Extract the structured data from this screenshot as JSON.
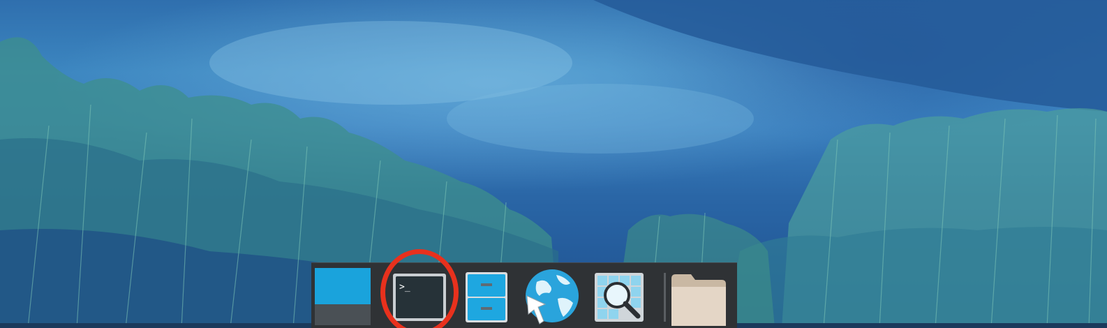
{
  "desktop": {
    "wallpaper": "blue-watercolor-lake-with-reeds",
    "colors": {
      "sky_light": "#6fb3dc",
      "water": "#3a7fbe",
      "reeds": "#4c9a9a",
      "dock_bg": "#2f3235",
      "highlight": "#e8311d"
    }
  },
  "dock": {
    "items": [
      {
        "name": "show-desktop",
        "icon": "show-desktop-icon"
      },
      {
        "name": "terminal",
        "icon": "terminal-icon",
        "prompt": ">_",
        "highlighted": true
      },
      {
        "name": "file-manager",
        "icon": "file-cabinet-icon"
      },
      {
        "name": "web-browser",
        "icon": "globe-cursor-icon"
      },
      {
        "name": "app-finder",
        "icon": "magnifier-grid-icon"
      },
      {
        "name": "home-folder",
        "icon": "folder-icon"
      }
    ]
  }
}
